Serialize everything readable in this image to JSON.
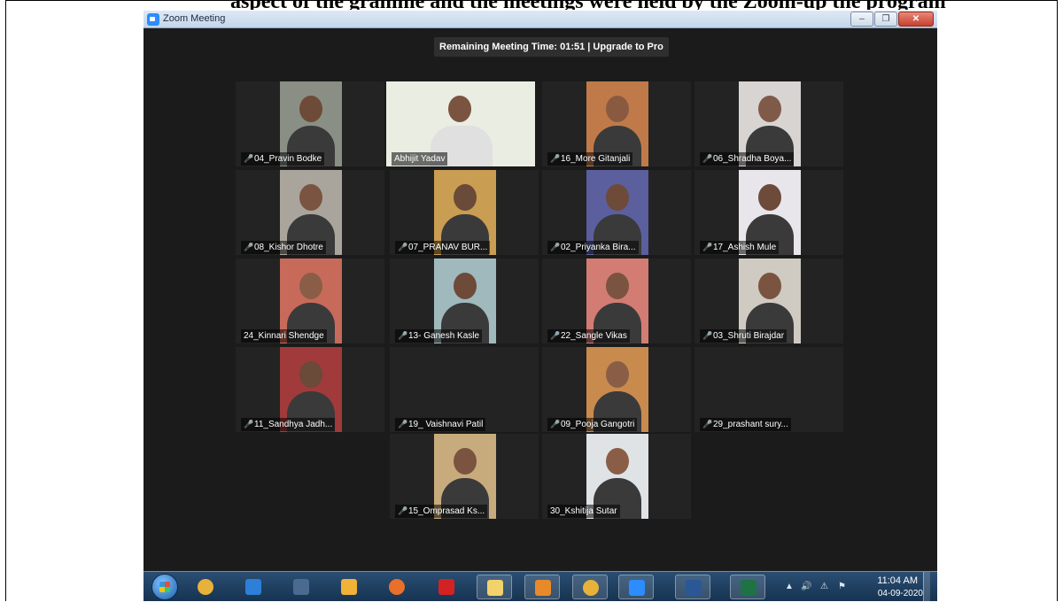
{
  "document": {
    "heading": "aspect of the gramme and the meetings were held by the Zoom-up the program"
  },
  "window": {
    "title": "Zoom Meeting"
  },
  "meeting": {
    "remaining_label": "Remaining Meeting Time: 01:51 | Upgrade to Pro"
  },
  "participants": [
    {
      "name": "04_Pravin Bodke",
      "muted": true
    },
    {
      "name": "Abhijit Yadav",
      "muted": false,
      "active_speaker": true
    },
    {
      "name": "16_More Gitanjali",
      "muted": true
    },
    {
      "name": "06_Shradha Boya...",
      "muted": true
    },
    {
      "name": "08_Kishor Dhotre",
      "muted": true
    },
    {
      "name": "07_PRANAV BUR...",
      "muted": true
    },
    {
      "name": "02_Priyanka Bira...",
      "muted": true
    },
    {
      "name": "17_Ashish Mule",
      "muted": true
    },
    {
      "name": "24_Kinnari Shendge",
      "muted": false
    },
    {
      "name": "13- Ganesh Kasle",
      "muted": true
    },
    {
      "name": "22_Sangle Vikas",
      "muted": true
    },
    {
      "name": "03_Shruti Birajdar",
      "muted": true
    },
    {
      "name": "11_Sandhya Jadh...",
      "muted": true
    },
    {
      "name": "19_ Vaishnavi Patil",
      "muted": true
    },
    {
      "name": "09_Pooja Gangotri",
      "muted": true
    },
    {
      "name": "29_prashant sury...",
      "muted": true
    },
    {
      "name": "15_Omprasad Ks...",
      "muted": true
    },
    {
      "name": "30_Kshitija Sutar",
      "muted": false
    }
  ],
  "colors": {
    "meeting_bg": "#1b1b1b",
    "tile_bg": "#232323",
    "active_speaker_border": "#c8e36a",
    "muted_icon": "#ff3b30"
  },
  "taskbar": {
    "pinned": [
      {
        "icon": "chrome-icon"
      },
      {
        "icon": "internet-explorer-icon"
      },
      {
        "icon": "publisher-icon"
      },
      {
        "icon": "college-logo-icon"
      },
      {
        "icon": "firefox-icon"
      },
      {
        "icon": "adobe-reader-icon"
      },
      {
        "icon": "file-explorer-icon"
      },
      {
        "icon": "media-player-icon"
      },
      {
        "icon": "chrome-icon"
      },
      {
        "icon": "zoom-icon"
      },
      {
        "icon": "word-icon"
      },
      {
        "icon": "excel-icon"
      }
    ],
    "clock_time": "11:04 AM",
    "clock_date": "04-09-2020"
  }
}
